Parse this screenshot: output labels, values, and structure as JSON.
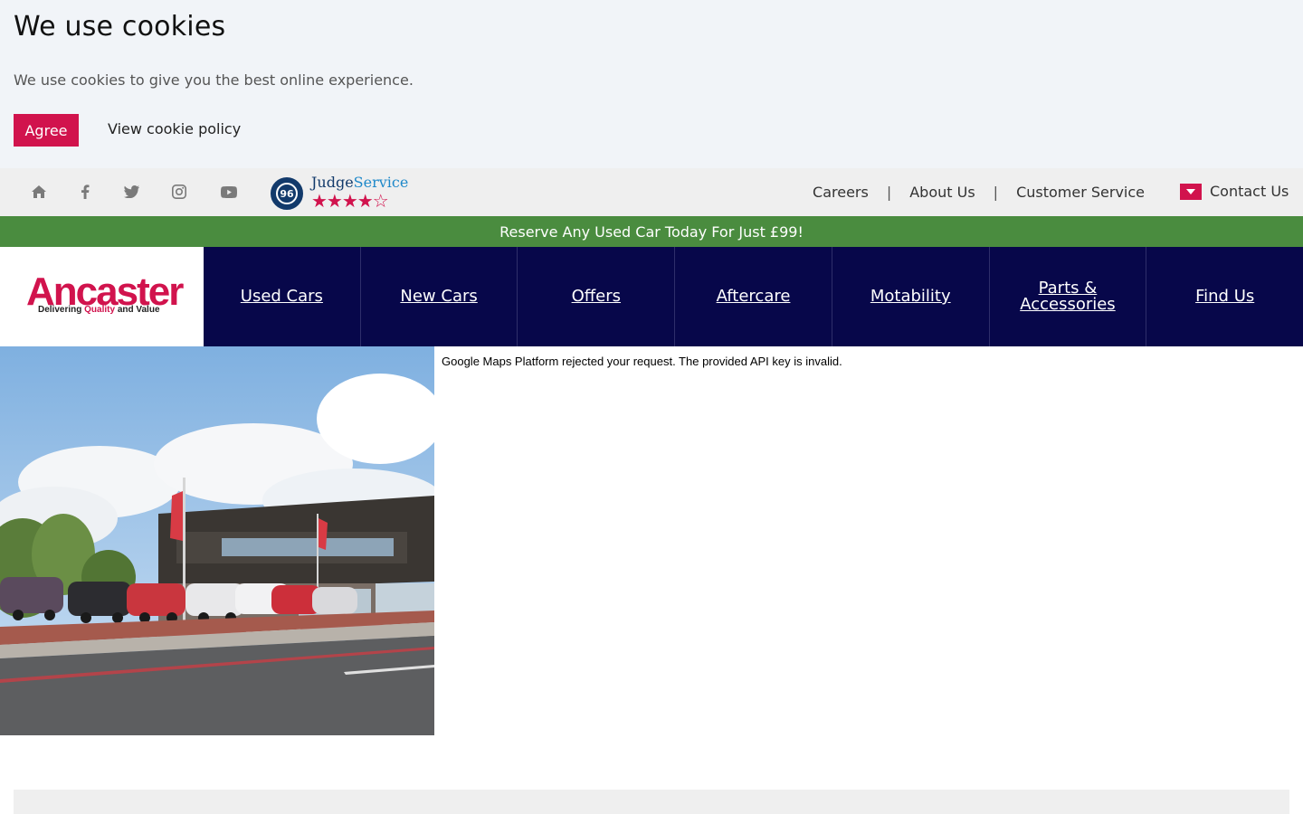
{
  "cookie": {
    "title": "We use cookies",
    "text": "We use cookies to give you the best online experience.",
    "agree_label": "Agree",
    "policy_label": "View cookie policy"
  },
  "utility": {
    "social_icons": [
      "home-icon",
      "facebook-icon",
      "twitter-icon",
      "instagram-icon",
      "youtube-icon"
    ],
    "judge_service": {
      "score": "96",
      "name_prefix": "Judge",
      "name_suffix": "Service",
      "stars": "★★★★☆",
      "rating": 4.5
    },
    "links": [
      "Careers",
      "About Us",
      "Customer Service"
    ],
    "separator": "|",
    "contact_label": "Contact Us"
  },
  "promo": {
    "text": "Reserve Any Used Car Today For Just £99!"
  },
  "brand": {
    "name": "Ancaster",
    "tag_1": "Delivering ",
    "tag_2": "Quality",
    "tag_3": " and Value",
    "accent": "#d1134d",
    "nav_bg": "#07074a",
    "promo_bg": "#4a8c3f"
  },
  "nav": {
    "items": [
      "Used Cars",
      "New Cars",
      "Offers",
      "Aftercare",
      "Motability",
      "Parts & Accessories",
      "Find Us"
    ]
  },
  "map": {
    "error": "Google Maps Platform rejected your request. The provided API key is invalid."
  }
}
